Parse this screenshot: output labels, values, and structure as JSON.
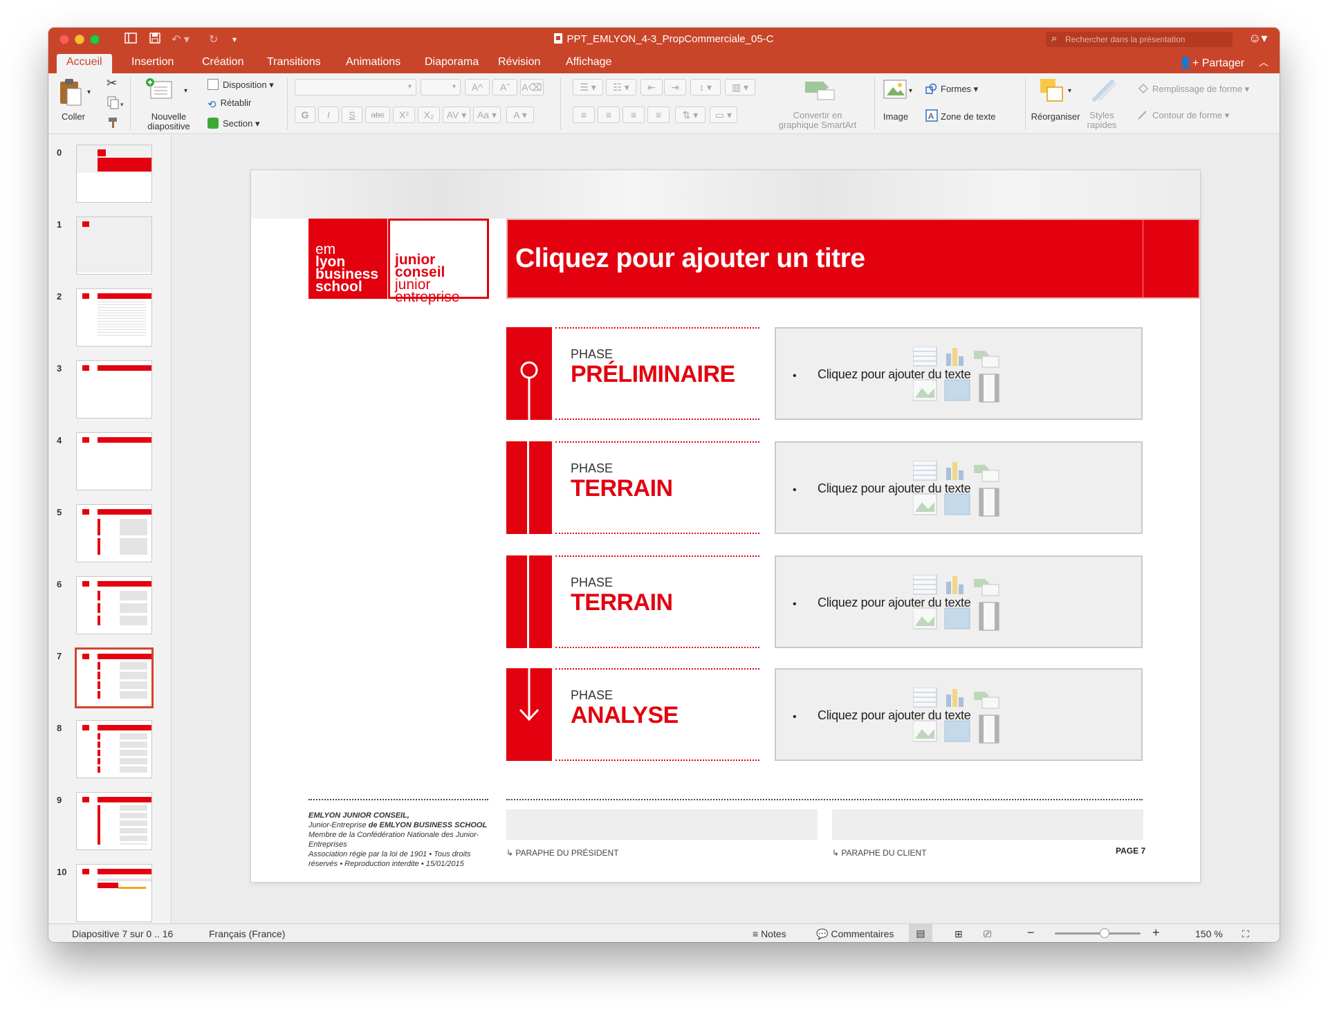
{
  "window": {
    "title": "PPT_EMLYON_4-3_PropCommerciale_05-C",
    "search_placeholder": "Rechercher dans la présentation"
  },
  "tabs": [
    {
      "label": "Accueil",
      "active": true
    },
    {
      "label": "Insertion"
    },
    {
      "label": "Création"
    },
    {
      "label": "Transitions"
    },
    {
      "label": "Animations"
    },
    {
      "label": "Diaporama"
    },
    {
      "label": "Révision"
    },
    {
      "label": "Affichage"
    }
  ],
  "share_label": "Partager",
  "ribbon": {
    "paste": "Coller",
    "new_slide": [
      "Nouvelle",
      "diapositive"
    ],
    "layout": "Disposition",
    "reset": "Rétablir",
    "section": "Section",
    "smartart": [
      "Convertir en",
      "graphique SmartArt"
    ],
    "image": "Image",
    "shapes": "Formes",
    "textbox": "Zone de texte",
    "arrange": "Réorganiser",
    "quick_styles": [
      "Styles",
      "rapides"
    ],
    "shape_fill": "Remplissage de forme",
    "shape_outline": "Contour de forme",
    "font_buttons": [
      "G",
      "I",
      "S",
      "abc",
      "X²",
      "X₂"
    ]
  },
  "thumbnails": [
    "0",
    "1",
    "2",
    "3",
    "4",
    "5",
    "6",
    "7",
    "8",
    "9",
    "10"
  ],
  "selected_thumbnail": "7",
  "slide": {
    "logo_left": [
      "em",
      "lyon",
      "business",
      "school"
    ],
    "logo_right": [
      "junior conseil",
      "junior",
      "entreprise"
    ],
    "title": "Cliquez pour ajouter un titre",
    "phases": [
      {
        "label": "PHASE",
        "title": "PRÉLIMINAIRE",
        "bullet": "•",
        "text": "Cliquez pour ajouter du texte"
      },
      {
        "label": "PHASE",
        "title": "TERRAIN",
        "bullet": "•",
        "text": "Cliquez pour ajouter du texte"
      },
      {
        "label": "PHASE",
        "title": "TERRAIN",
        "bullet": "•",
        "text": "Cliquez pour ajouter du texte"
      },
      {
        "label": "PHASE",
        "title": "ANALYSE",
        "bullet": "•",
        "text": "Cliquez pour ajouter du texte"
      }
    ],
    "footer": {
      "company": "EMLYON JUNIOR CONSEIL,",
      "line2_a": "Junior-Entreprise ",
      "line2_b": "de EMLYON BUSINESS SCHOOL",
      "line3": "Membre de la Confédération Nationale des Junior-Entreprises",
      "line4": "Association régie par la loi de 1901 • Tous droits réservés • Reproduction interdite • 15/01/2015",
      "sign_president": "↳ PARAPHE DU PRÉSIDENT",
      "sign_client": "↳ PARAPHE DU CLIENT",
      "page": "PAGE 7"
    }
  },
  "status": {
    "slide_info": "Diapositive 7 sur 0 .. 16",
    "language": "Français (France)",
    "notes": "Notes",
    "comments": "Commentaires",
    "zoom": "150 %",
    "zoom_level": 0.58
  },
  "colors": {
    "accent": "#c9452a",
    "brand_red": "#e3000f"
  }
}
